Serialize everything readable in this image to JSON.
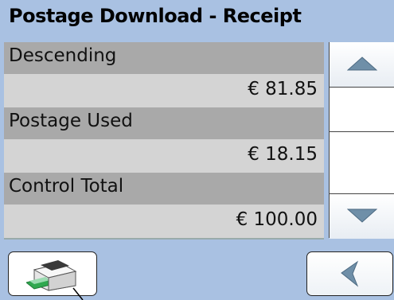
{
  "title": "Postage Download - Receipt",
  "rows": [
    {
      "label": "Descending",
      "value": "€ 81.85"
    },
    {
      "label": "Postage Used",
      "value": "€ 18.15"
    },
    {
      "label": "Control Total",
      "value": "€ 100.00"
    }
  ],
  "icons": {
    "scroll_up": "triangle-up-icon",
    "scroll_down": "triangle-down-icon",
    "print": "printer-icon",
    "back": "back-arrow-icon"
  },
  "colors": {
    "background": "#a9c1e2",
    "label_row": "#a9a9a9",
    "value_row": "#d4d4d4",
    "arrow": "#6f8fa8"
  }
}
